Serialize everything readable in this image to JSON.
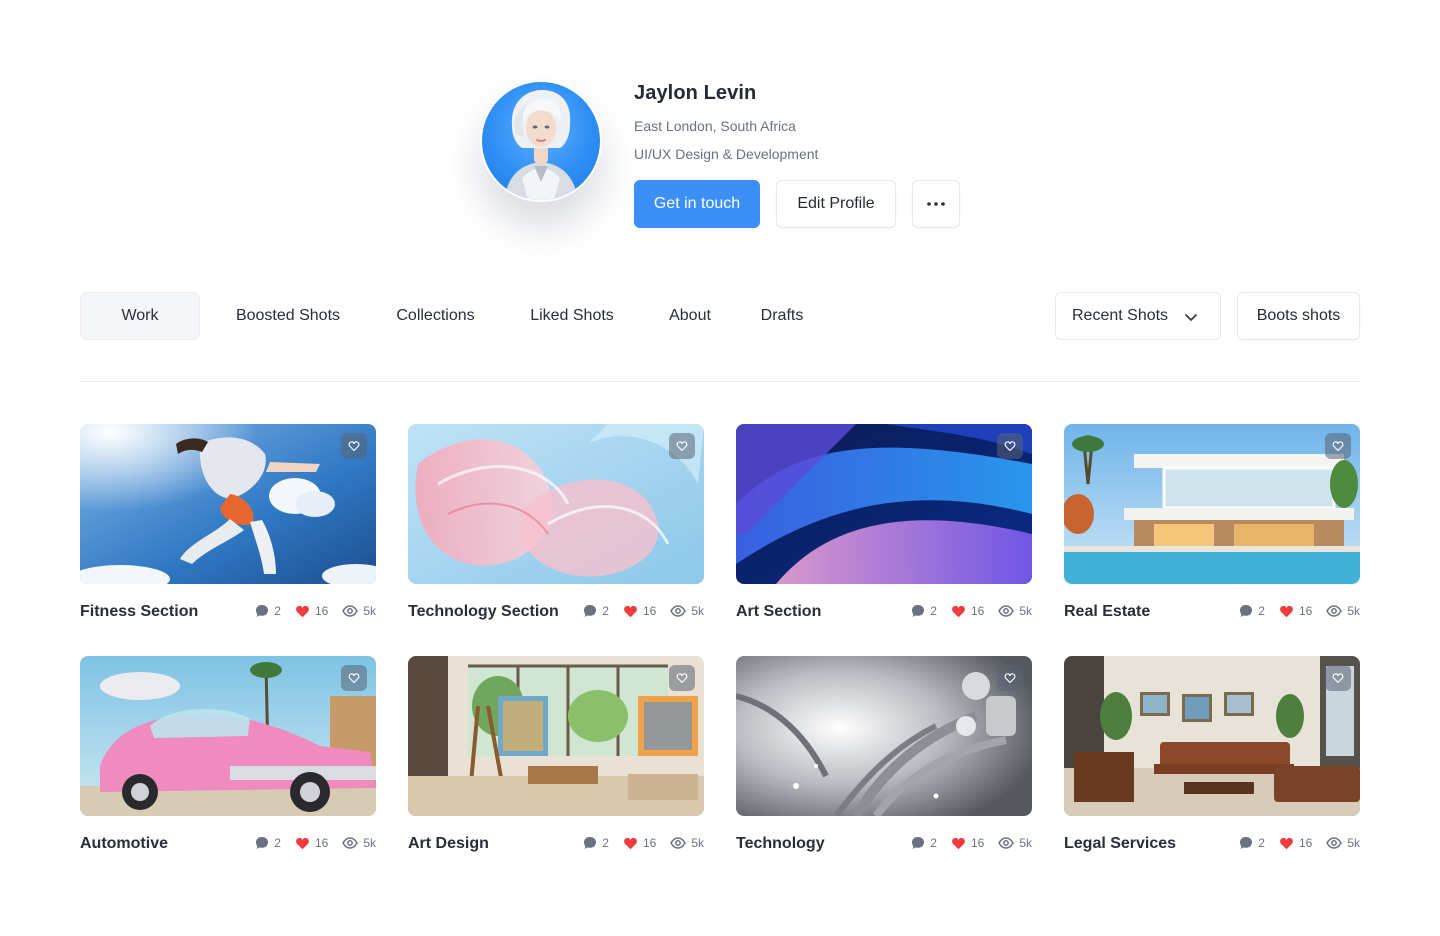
{
  "profile": {
    "name": "Jaylon Levin",
    "location": "East London, South Africa",
    "role": "UI/UX Design & Development",
    "primary_button": "Get in touch",
    "secondary_button": "Edit Profile",
    "more_button": "···",
    "accent_color": "#3b8ff7"
  },
  "tabs": [
    {
      "label": "Work",
      "active": true
    },
    {
      "label": "Boosted Shots",
      "active": false
    },
    {
      "label": "Collections",
      "active": false
    },
    {
      "label": "Liked Shots",
      "active": false
    },
    {
      "label": "About",
      "active": false
    },
    {
      "label": "Drafts",
      "active": false
    }
  ],
  "filter": {
    "dropdown_label": "Recent Shots",
    "boost_button": "Boots shots"
  },
  "shots": [
    {
      "title": "Fitness Section",
      "comments": "2",
      "likes": "16",
      "views": "5k"
    },
    {
      "title": "Technology Section",
      "comments": "2",
      "likes": "16",
      "views": "5k"
    },
    {
      "title": "Art Section",
      "comments": "2",
      "likes": "16",
      "views": "5k"
    },
    {
      "title": "Real Estate",
      "comments": "2",
      "likes": "16",
      "views": "5k"
    },
    {
      "title": "Automotive",
      "comments": "2",
      "likes": "16",
      "views": "5k"
    },
    {
      "title": "Art Design",
      "comments": "2",
      "likes": "16",
      "views": "5k"
    },
    {
      "title": "Technology",
      "comments": "2",
      "likes": "16",
      "views": "5k"
    },
    {
      "title": "Legal Services",
      "comments": "2",
      "likes": "16",
      "views": "5k"
    }
  ],
  "icons": {
    "comment": "comment-icon",
    "like": "heart-icon",
    "views": "eye-icon",
    "favorite": "heart-outline-icon",
    "dropdown": "chevron-down-icon",
    "more": "more-dots-icon"
  },
  "colors": {
    "like": "#ef3b3b",
    "text_muted": "#6b7180"
  }
}
